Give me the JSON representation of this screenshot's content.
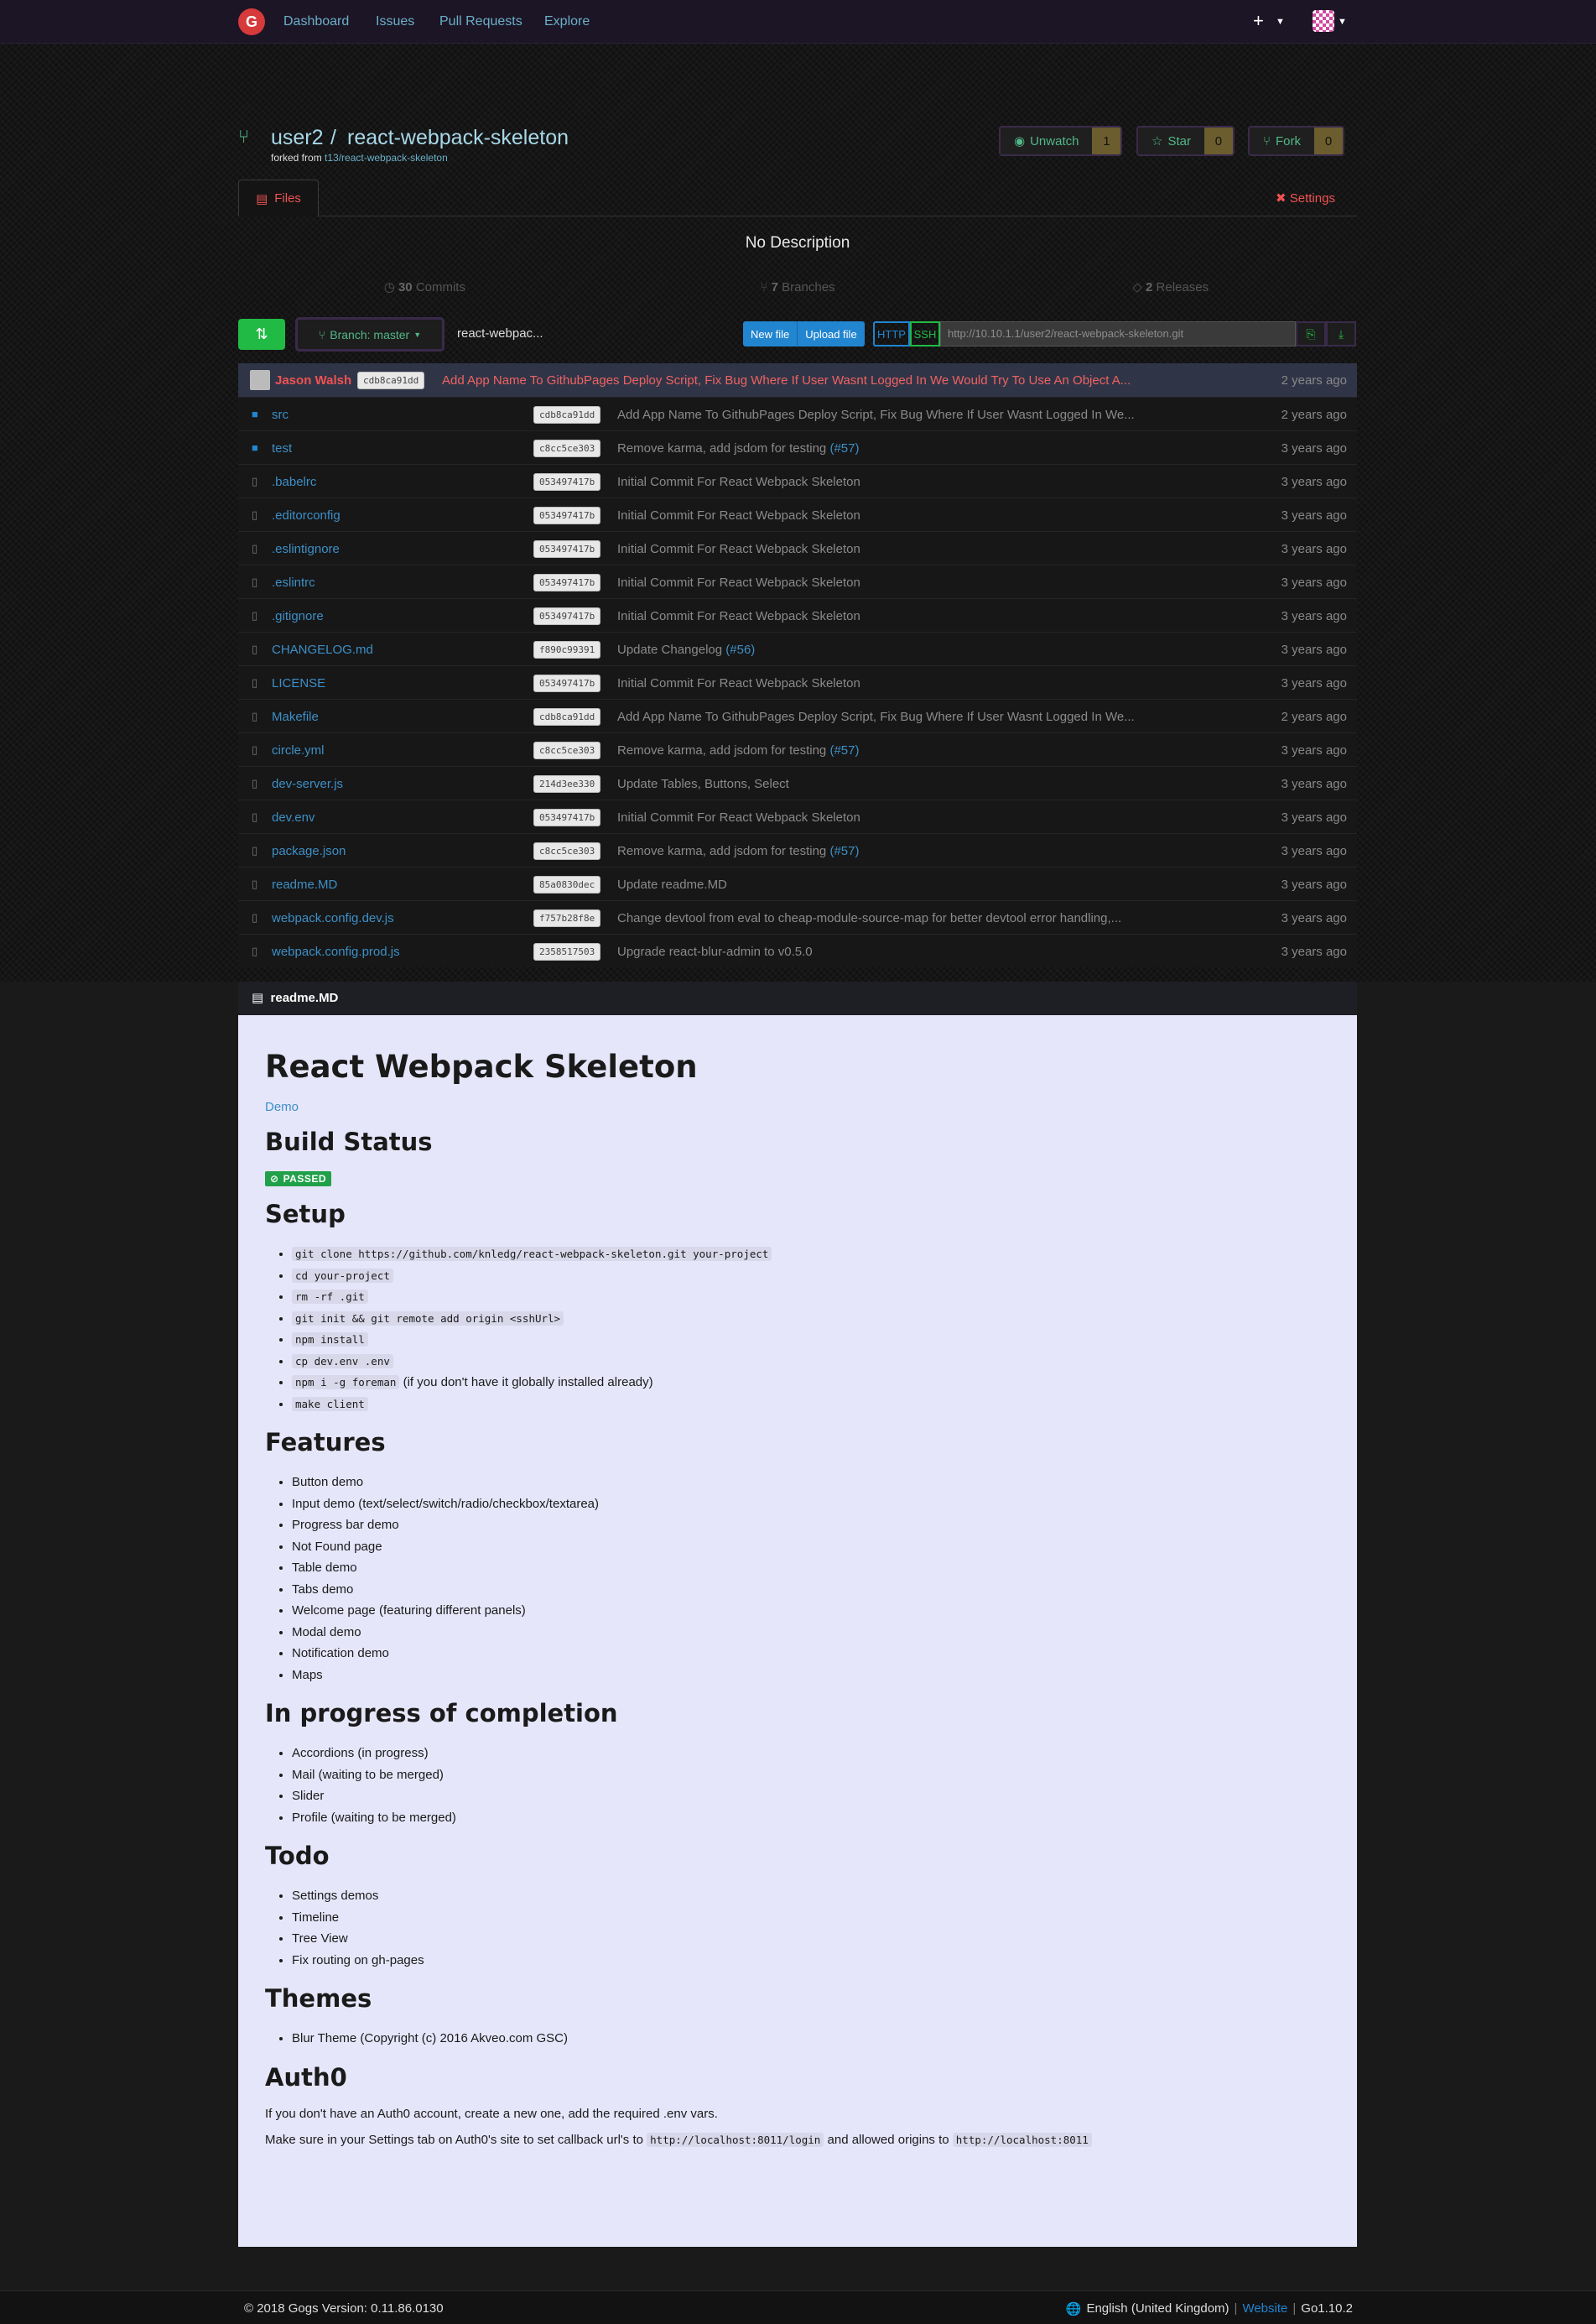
{
  "nav": {
    "logo": "G",
    "links": [
      "Dashboard",
      "Issues",
      "Pull Requests",
      "Explore"
    ],
    "plus": "+"
  },
  "repo": {
    "owner": "user2",
    "name": "react-webpack-skeleton",
    "forked_prefix": "forked from ",
    "forked_source": "t13/react-webpack-skeleton",
    "watch_label": "Unwatch",
    "watch_count": "1",
    "star_label": "Star",
    "star_count": "0",
    "fork_label": "Fork",
    "fork_count": "0",
    "tab_files": "Files",
    "settings": "Settings",
    "description": "No Description",
    "commits_count": "30",
    "commits_label": "Commits",
    "branches_count": "7",
    "branches_label": "Branches",
    "releases_count": "2",
    "releases_label": "Releases"
  },
  "toolbar": {
    "branch": "Branch: master",
    "path": "react-webpac...",
    "new_file": "New file",
    "upload_file": "Upload file",
    "http": "HTTP",
    "ssh": "SSH",
    "clone_url": "http://10.10.1.1/user2/react-webpack-skeleton.git"
  },
  "latest_commit": {
    "author": "Jason Walsh",
    "sha": "cdb8ca91dd",
    "message": "Add App Name To GithubPages Deploy Script, Fix Bug Where If User Wasnt Logged In We Would Try To Use An Object A...",
    "age": "2 years ago"
  },
  "files": [
    {
      "name": "src",
      "type": "dir",
      "sha": "cdb8ca91dd",
      "message": "Add App Name To GithubPages Deploy Script, Fix Bug Where If User Wasnt Logged In We...",
      "age": "2 years ago"
    },
    {
      "name": "test",
      "type": "dir",
      "sha": "c8cc5ce303",
      "message": "Remove karma, add jsdom for testing (#57)",
      "age": "3 years ago"
    },
    {
      "name": ".babelrc",
      "type": "file",
      "sha": "053497417b",
      "message": "Initial Commit For React Webpack Skeleton",
      "age": "3 years ago"
    },
    {
      "name": ".editorconfig",
      "type": "file",
      "sha": "053497417b",
      "message": "Initial Commit For React Webpack Skeleton",
      "age": "3 years ago"
    },
    {
      "name": ".eslintignore",
      "type": "file",
      "sha": "053497417b",
      "message": "Initial Commit For React Webpack Skeleton",
      "age": "3 years ago"
    },
    {
      "name": ".eslintrc",
      "type": "file",
      "sha": "053497417b",
      "message": "Initial Commit For React Webpack Skeleton",
      "age": "3 years ago"
    },
    {
      "name": ".gitignore",
      "type": "file",
      "sha": "053497417b",
      "message": "Initial Commit For React Webpack Skeleton",
      "age": "3 years ago"
    },
    {
      "name": "CHANGELOG.md",
      "type": "file",
      "sha": "f890c99391",
      "message": "Update Changelog (#56)",
      "age": "3 years ago"
    },
    {
      "name": "LICENSE",
      "type": "file",
      "sha": "053497417b",
      "message": "Initial Commit For React Webpack Skeleton",
      "age": "3 years ago"
    },
    {
      "name": "Makefile",
      "type": "file",
      "sha": "cdb8ca91dd",
      "message": "Add App Name To GithubPages Deploy Script, Fix Bug Where If User Wasnt Logged In We...",
      "age": "2 years ago"
    },
    {
      "name": "circle.yml",
      "type": "file",
      "sha": "c8cc5ce303",
      "message": "Remove karma, add jsdom for testing (#57)",
      "age": "3 years ago"
    },
    {
      "name": "dev-server.js",
      "type": "file",
      "sha": "214d3ee330",
      "message": "Update Tables, Buttons, Select",
      "age": "3 years ago"
    },
    {
      "name": "dev.env",
      "type": "file",
      "sha": "053497417b",
      "message": "Initial Commit For React Webpack Skeleton",
      "age": "3 years ago"
    },
    {
      "name": "package.json",
      "type": "file",
      "sha": "c8cc5ce303",
      "message": "Remove karma, add jsdom for testing (#57)",
      "age": "3 years ago"
    },
    {
      "name": "readme.MD",
      "type": "file",
      "sha": "85a0830dec",
      "message": "Update readme.MD",
      "age": "3 years ago"
    },
    {
      "name": "webpack.config.dev.js",
      "type": "file",
      "sha": "f757b28f8e",
      "message": "Change devtool from eval to cheap-module-source-map for better devtool error handling,...",
      "age": "3 years ago"
    },
    {
      "name": "webpack.config.prod.js",
      "type": "file",
      "sha": "2358517503",
      "message": "Upgrade react-blur-admin to v0.5.0",
      "age": "3 years ago"
    }
  ],
  "readme": {
    "filename": "readme.MD",
    "title": "React Webpack Skeleton",
    "demo_link": "Demo",
    "build_heading": "Build Status",
    "badge": "PASSED",
    "setup_heading": "Setup",
    "setup_items": [
      "git clone https://github.com/knledg/react-webpack-skeleton.git your-project",
      "cd your-project",
      "rm -rf .git",
      "git init && git remote add origin <sshUrl>",
      "npm install",
      "cp dev.env .env",
      "npm i -g foreman",
      "make client"
    ],
    "setup_item7_suffix": " (if you don't have it globally installed already)",
    "features_heading": "Features",
    "features": [
      "Button demo",
      "Input demo (text/select/switch/radio/checkbox/textarea)",
      "Progress bar demo",
      "Not Found page",
      "Table demo",
      "Tabs demo",
      "Welcome page (featuring different panels)",
      "Modal demo",
      "Notification demo",
      "Maps"
    ],
    "progress_heading": "In progress of completion",
    "progress": [
      "Accordions (in progress)",
      "Mail (waiting to be merged)",
      "Slider",
      "Profile (waiting to be merged)"
    ],
    "todo_heading": "Todo",
    "todo": [
      "Settings demos",
      "Timeline",
      "Tree View",
      "Fix routing on gh-pages"
    ],
    "themes_heading": "Themes",
    "themes": [
      "Blur Theme (Copyright (c) 2016 Akveo.com GSC)"
    ],
    "auth_heading": "Auth0",
    "auth_p1": "If you don't have an Auth0 account, create a new one, add the required .env vars.",
    "auth_p2_a": "Make sure in your Settings tab on Auth0's site to set callback url's to ",
    "auth_p2_code1": "http://localhost:8011/login",
    "auth_p2_b": " and allowed origins to ",
    "auth_p2_code2": "http://localhost:8011"
  },
  "footer": {
    "copyright": "© 2018 Gogs Version: 0.11.86.0130",
    "language": "English (United Kingdom)",
    "website": "Website",
    "go_version": "Go1.10.2"
  }
}
